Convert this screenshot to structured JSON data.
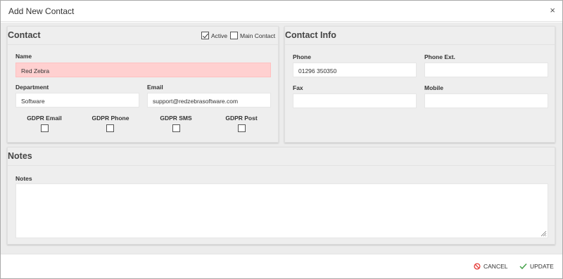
{
  "dialog": {
    "title": "Add New Contact",
    "close_glyph": "×"
  },
  "contact": {
    "section_title": "Contact",
    "active_label": "Active",
    "active_checked": true,
    "main_contact_label": "Main Contact",
    "main_contact_checked": false,
    "name_label": "Name",
    "name_value": "Red Zebra",
    "department_label": "Department",
    "department_value": "Software",
    "email_label": "Email",
    "email_value": "support@redzebrasoftware.com",
    "gdpr": [
      {
        "label": "GDPR Email",
        "checked": false
      },
      {
        "label": "GDPR Phone",
        "checked": false
      },
      {
        "label": "GDPR SMS",
        "checked": false
      },
      {
        "label": "GDPR Post",
        "checked": false
      }
    ]
  },
  "contact_info": {
    "section_title": "Contact Info",
    "phone_label": "Phone",
    "phone_value": "01296 350350",
    "phone_ext_label": "Phone Ext.",
    "phone_ext_value": "",
    "fax_label": "Fax",
    "fax_value": "",
    "mobile_label": "Mobile",
    "mobile_value": ""
  },
  "notes": {
    "section_title": "Notes",
    "notes_label": "Notes",
    "notes_value": ""
  },
  "footer": {
    "cancel_label": "CANCEL",
    "update_label": "UPDATE",
    "cancel_icon": "ban-icon",
    "update_icon": "check-icon"
  },
  "colors": {
    "error_field_bg": "#ffd0d0",
    "cancel_icon": "#e53935",
    "update_icon": "#43a047"
  }
}
